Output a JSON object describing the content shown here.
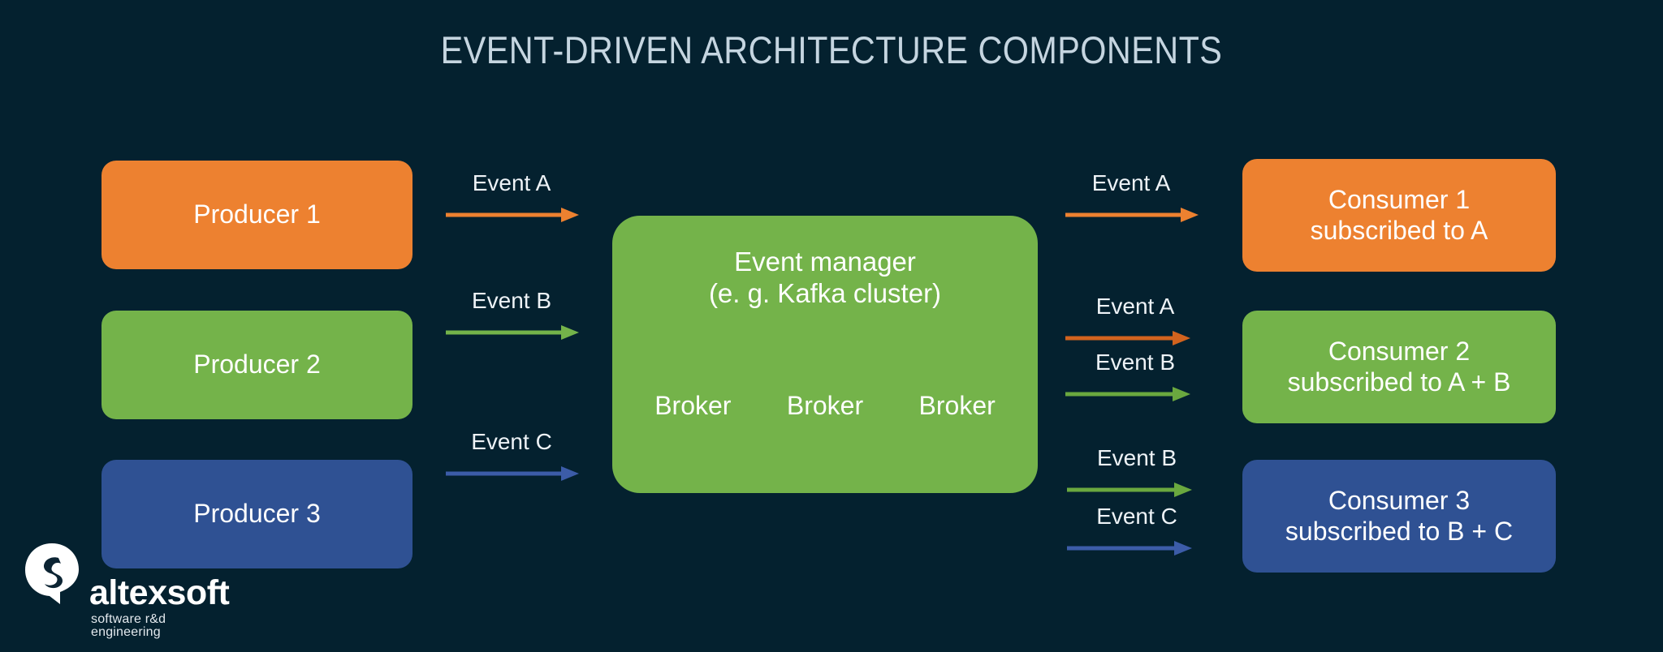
{
  "title": "EVENT-DRIVEN ARCHITECTURE COMPONENTS",
  "colors": {
    "background": "#04212f",
    "orange": "#ed8130",
    "green": "#74b34a",
    "blue": "#2f5193",
    "title_text": "#c5d5e0",
    "label_text": "#eef3f7",
    "node_text": "#ffffff"
  },
  "producers": [
    {
      "label": "Producer 1",
      "color": "orange"
    },
    {
      "label": "Producer 2",
      "color": "green"
    },
    {
      "label": "Producer 3",
      "color": "blue"
    }
  ],
  "event_manager": {
    "title": "Event manager\n(e. g. Kafka cluster)",
    "brokers": [
      "Broker",
      "Broker",
      "Broker"
    ]
  },
  "inbound_flows": [
    {
      "label": "Event A",
      "color": "orange"
    },
    {
      "label": "Event B",
      "color": "green"
    },
    {
      "label": "Event C",
      "color": "blue"
    }
  ],
  "outbound_flows": [
    {
      "label": "Event A",
      "color": "orange"
    },
    {
      "label": "Event A",
      "color": "orange"
    },
    {
      "label": "Event B",
      "color": "green"
    },
    {
      "label": "Event B",
      "color": "green"
    },
    {
      "label": "Event C",
      "color": "blue"
    }
  ],
  "consumers": [
    {
      "line1": "Consumer 1",
      "line2": "subscribed to A",
      "color": "orange"
    },
    {
      "line1": "Consumer 2",
      "line2": "subscribed to A + B",
      "color": "green"
    },
    {
      "line1": "Consumer 3",
      "line2": "subscribed to B + C",
      "color": "blue"
    }
  ],
  "logo": {
    "wordmark": "altexsoft",
    "tagline": "software r&d engineering"
  }
}
